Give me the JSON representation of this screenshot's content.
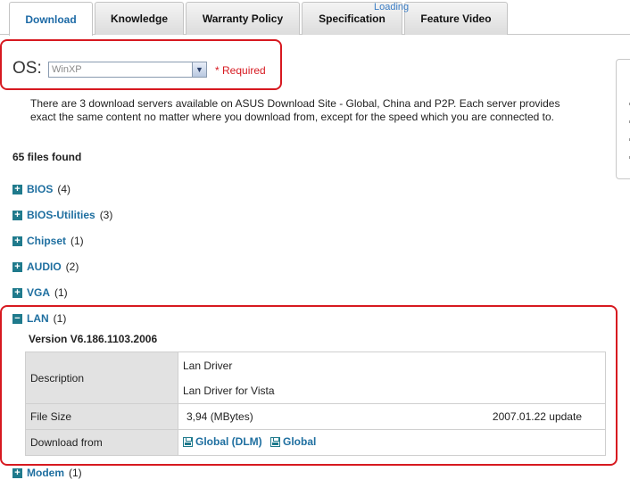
{
  "tabs": [
    {
      "label": "Download",
      "active": true
    },
    {
      "label": "Knowledge",
      "active": false
    },
    {
      "label": "Warranty Policy",
      "active": false
    },
    {
      "label": "Specification",
      "active": false
    },
    {
      "label": "Feature Video",
      "active": false
    }
  ],
  "loading_text": "Loading",
  "os": {
    "label": "OS:",
    "selected": "WinXP",
    "required_text": "* Required"
  },
  "intro_text": "There are 3 download servers available on ASUS Download Site - Global, China and P2P. Each server provides exact the same content no matter where you download from, except for the speed which you are connected to.",
  "files_found": "65 files found",
  "categories": [
    {
      "name": "BIOS",
      "count": "(4)",
      "expanded": false
    },
    {
      "name": "BIOS-Utilities",
      "count": "(3)",
      "expanded": false
    },
    {
      "name": "Chipset",
      "count": "(1)",
      "expanded": false
    },
    {
      "name": "AUDIO",
      "count": "(2)",
      "expanded": false
    },
    {
      "name": "VGA",
      "count": "(1)",
      "expanded": false
    },
    {
      "name": "LAN",
      "count": "(1)",
      "expanded": true
    },
    {
      "name": "Modem",
      "count": "(1)",
      "expanded": false
    }
  ],
  "lan_detail": {
    "version": "Version  V6.186.1103.2006",
    "description_label": "Description",
    "description_lines": [
      "Lan Driver",
      "Lan Driver for Vista"
    ],
    "filesize_label": "File Size",
    "filesize_value": "3,94 (MBytes)",
    "date_text": "2007.01.22  update",
    "download_label": "Download from",
    "download_links": [
      "Global (DLM)",
      "Global"
    ]
  },
  "colors": {
    "accent_blue": "#1f6fa0",
    "highlight_red": "#d71920",
    "icon_teal": "#1f7a8c"
  }
}
